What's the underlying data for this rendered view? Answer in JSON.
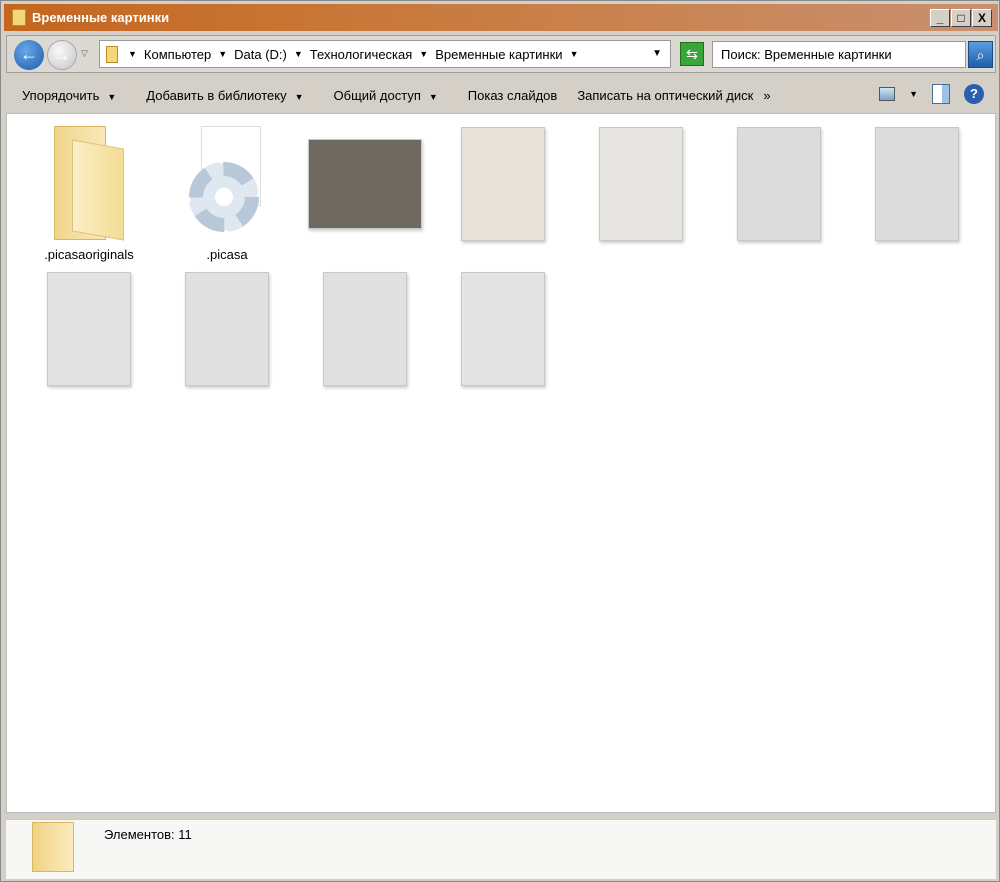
{
  "window": {
    "title": "Временные картинки",
    "minimize": "_",
    "maximize": "□",
    "close": "X"
  },
  "nav": {
    "back_glyph": "←",
    "forward_glyph": "→",
    "breadcrumb": [
      "Компьютер",
      "Data (D:)",
      "Технологическая",
      "Временные картинки"
    ],
    "search_placeholder": "Поиск: Временные картинки"
  },
  "toolbar": {
    "organize": "Упорядочить",
    "add_library": "Добавить в библиотеку",
    "share": "Общий доступ",
    "slideshow": "Показ слайдов",
    "burn": "Записать на оптический диск",
    "more": "»",
    "help": "?"
  },
  "items": [
    {
      "name": ".picasaoriginals",
      "type": "folder"
    },
    {
      "name": ".picasa",
      "type": "settings-file"
    },
    {
      "name": "",
      "type": "photo",
      "color": "#6e6a62"
    },
    {
      "name": "",
      "type": "photo",
      "color": "#e9e2da"
    },
    {
      "name": "",
      "type": "photo",
      "color": "#e7e5e2"
    },
    {
      "name": "",
      "type": "photo",
      "color": "#dcdcdc"
    },
    {
      "name": "",
      "type": "photo",
      "color": "#dcdcdc"
    },
    {
      "name": "",
      "type": "photo",
      "color": "#e2e2e2"
    },
    {
      "name": "",
      "type": "photo",
      "color": "#e0e0e0"
    },
    {
      "name": "",
      "type": "photo",
      "color": "#e0e0e0"
    },
    {
      "name": "",
      "type": "photo",
      "color": "#e4e4e4"
    }
  ],
  "status": {
    "count": "Элементов: 11"
  }
}
